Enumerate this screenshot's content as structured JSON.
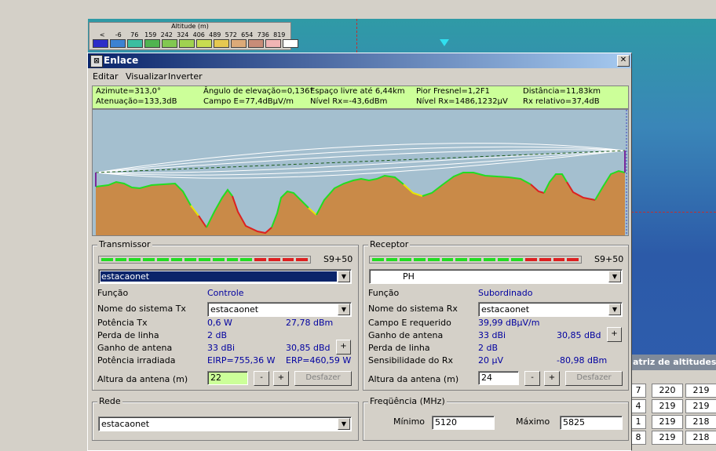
{
  "legend": {
    "title": "Altitude (m)",
    "labels": [
      "<",
      "-6",
      "76",
      "159",
      "242",
      "324",
      "406",
      "489",
      "572",
      "654",
      "736",
      "819"
    ],
    "colors": [
      "#2d2dc8",
      "#3c82d2",
      "#3cbea0",
      "#50b450",
      "#82c850",
      "#a0d250",
      "#c8dc50",
      "#e6c850",
      "#dcaa78",
      "#c88c78",
      "#f0b4b4",
      "#ffffff"
    ]
  },
  "window": {
    "title": "Enlace",
    "close_label": "✕",
    "menu": [
      "Editar",
      "Visualizar",
      "Inverter"
    ]
  },
  "info": {
    "azimute": "Azimute=313,0°",
    "angulo": "Ângulo de elevação=0,136°",
    "espaco": "Espaço livre até 6,44km",
    "fresnel": "Pior Fresnel=1,2F1",
    "distancia": "Distância=11,83km",
    "atenuacao": "Atenuação=133,3dB",
    "campo": "Campo E=77,4dBµV/m",
    "nivel_dbm": "Nível Rx=-43,6dBm",
    "nivel_uv": "Nível Rx=1486,1232µV",
    "rx_relativo": "Rx relativo=37,4dB"
  },
  "transmissor": {
    "title": "Transmissor",
    "signal_label": "S9+50",
    "station": "estacaonet",
    "funcao_label": "Função",
    "funcao_value": "Controle",
    "nome_label": "Nome do sistema Tx",
    "nome_value": "estacaonet",
    "potencia_label": "Potência Tx",
    "potencia_w": "0,6 W",
    "potencia_dbm": "27,78 dBm",
    "perda_label": "Perda de linha",
    "perda_value": "2 dB",
    "ganho_label": "Ganho de antena",
    "ganho_dbi": "33 dBi",
    "ganho_dbd": "30,85 dBd",
    "plus": "+",
    "irradiada_label": "Potência irradiada",
    "eirp": "EIRP=755,36 W",
    "erp": "ERP=460,59 W",
    "altura_label": "Altura da antena (m)",
    "altura_value": "22",
    "minus": "-",
    "desfazer": "Desfazer"
  },
  "receptor": {
    "title": "Receptor",
    "signal_label": "S9+50",
    "station": "PH",
    "funcao_label": "Função",
    "funcao_value": "Subordinado",
    "nome_label": "Nome do sistema Rx",
    "nome_value": "estacaonet",
    "campo_label": "Campo E requerido",
    "campo_value": "39,99 dBµV/m",
    "ganho_label": "Ganho de antena",
    "ganho_dbi": "33 dBi",
    "ganho_dbd": "30,85 dBd",
    "plus": "+",
    "perda_label": "Perda de linha",
    "perda_value": "2 dB",
    "sens_label": "Sensibilidade do Rx",
    "sens_uv": "20 µV",
    "sens_dbm": "-80,98 dBm",
    "altura_label": "Altura da antena (m)",
    "altura_value": "24",
    "minus": "-",
    "desfazer": "Desfazer"
  },
  "rede": {
    "title": "Rede",
    "value": "estacaonet"
  },
  "frequencia": {
    "title": "Freqüência (MHz)",
    "min_label": "Mínimo",
    "min_value": "5120",
    "max_label": "Máximo",
    "max_value": "5825"
  },
  "matriz": {
    "title": "atriz de altitudes (",
    "rows": [
      [
        "7",
        "220",
        "219"
      ],
      [
        "4",
        "219",
        "219"
      ],
      [
        "1",
        "219",
        "218"
      ],
      [
        "8",
        "219",
        "218"
      ]
    ]
  }
}
